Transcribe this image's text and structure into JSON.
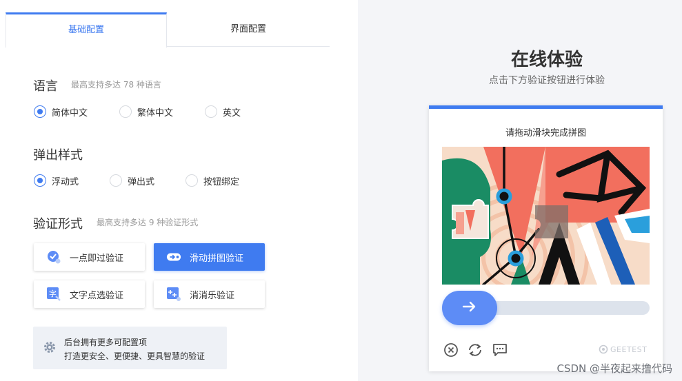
{
  "tabs": [
    {
      "label": "基础配置",
      "active": true
    },
    {
      "label": "界面配置",
      "active": false
    }
  ],
  "language": {
    "title": "语言",
    "hint": "最高支持多达 78 种语言",
    "options": [
      "简体中文",
      "繁体中文",
      "英文"
    ],
    "selected": "简体中文"
  },
  "popup_style": {
    "title": "弹出样式",
    "options": [
      "浮动式",
      "弹出式",
      "按钮绑定"
    ],
    "selected": "浮动式"
  },
  "verify_form": {
    "title": "验证形式",
    "hint": "最高支持多达 9 种验证形式",
    "buttons": [
      {
        "label": "一点即过验证",
        "icon": "check-shield-icon"
      },
      {
        "label": "滑动拼图验证",
        "icon": "slide-icon",
        "active": true
      },
      {
        "label": "文字点选验证",
        "icon": "text-char-icon"
      },
      {
        "label": "消消乐验证",
        "icon": "sparkle-icon"
      }
    ]
  },
  "info": {
    "line1": "后台拥有更多可配置项",
    "line2": "打造更安全、更便捷、更具智慧的验证"
  },
  "preview": {
    "title": "在线体验",
    "subtitle": "点击下方验证按钮进行体验",
    "captcha_prompt": "请拖动滑块完成拼图",
    "brand": "GEETEST"
  },
  "watermark": "CSDN @半夜起来撸代码",
  "colors": {
    "accent": "#3f7bf0",
    "slider": "#5d8cf6",
    "puzzle_coral": "#f26f5e",
    "puzzle_green": "#1a8c64",
    "puzzle_cream": "#f7dcc8"
  }
}
